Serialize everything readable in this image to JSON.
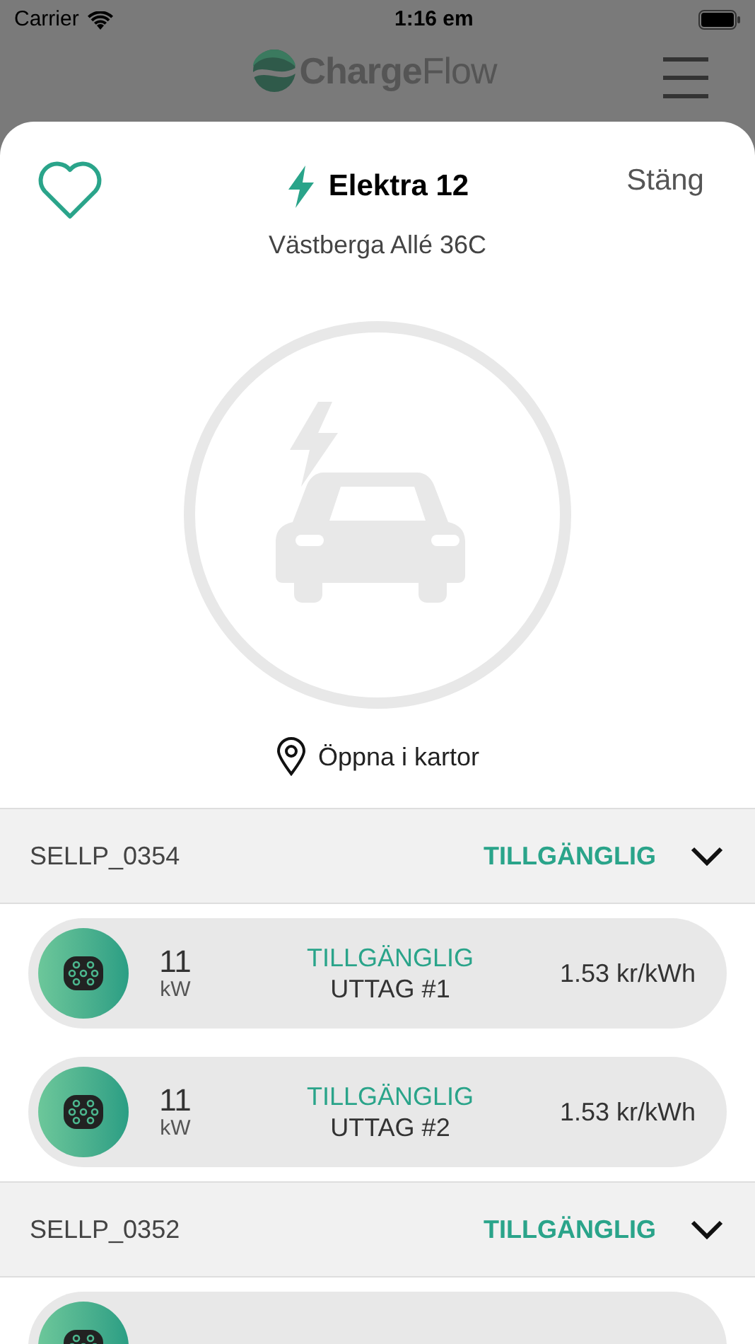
{
  "status_bar": {
    "carrier": "Carrier",
    "time": "1:16 em"
  },
  "header": {
    "logo": "**Charge**Flow"
  },
  "sheet": {
    "favorite": false,
    "title": "Elektra 12",
    "close": "Stäng",
    "address": "Västberga Allé 36C",
    "map_link": "Öppna i kartor"
  },
  "stations": [
    {
      "id": "SELLP_0354",
      "status": "TILLGÄNGLIG",
      "expanded": true,
      "outlets": [
        {
          "kind": "full",
          "power": "11",
          "unit": "kW",
          "status": "TILLGÄNGLIG",
          "name": "UTTAG #1",
          "price": "1.53 kr/kWh"
        },
        {
          "kind": "full",
          "power": "11",
          "unit": "kW",
          "status": "TILLGÄNGLIG",
          "name": "UTTAG #2",
          "price": "1.53 kr/kWh"
        }
      ]
    },
    {
      "id": "SELLP_0352",
      "status": "TILLGÄNGLIG",
      "expanded": true,
      "outlets": [
        {
          "kind": "cut"
        }
      ]
    }
  ]
}
